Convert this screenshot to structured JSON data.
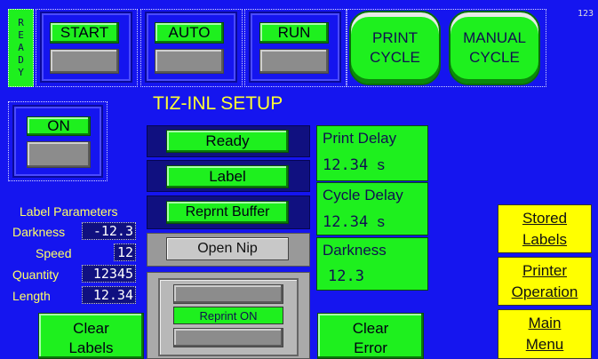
{
  "status": {
    "ready_vertical": "READY",
    "corner": "123"
  },
  "top_buttons": {
    "start": "START",
    "auto": "AUTO",
    "run": "RUN"
  },
  "cycle_buttons": {
    "print_line1": "PRINT",
    "print_line2": "CYCLE",
    "manual_line1": "MANUAL",
    "manual_line2": "CYCLE"
  },
  "title": "TIZ-INL SETUP",
  "on_button": "ON",
  "status_list": {
    "ready": "Ready",
    "label": "Label",
    "reprint_buffer": "Reprnt Buffer",
    "open_nip": "Open Nip"
  },
  "reprint": {
    "label": "Reprint ON"
  },
  "params": {
    "heading": "Label Parameters",
    "darkness_label": "Darkness",
    "darkness_value": "-12.3",
    "speed_label": "Speed",
    "speed_value": "12",
    "quantity_label": "Quantity",
    "quantity_value": "12345",
    "length_label": "Length",
    "length_value": "12.34"
  },
  "print_delay": {
    "label": "Print Delay",
    "value": "12.34",
    "unit": "s"
  },
  "cycle_delay": {
    "label": "Cycle Delay",
    "value": "12.34",
    "unit": "s"
  },
  "darkness_box": {
    "label": "Darkness",
    "value": "12.3"
  },
  "side_menu": {
    "stored_line1": "Stored",
    "stored_line2": "Labels",
    "printer_line1": "Printer",
    "printer_line2": "Operation",
    "main_line1": "Main",
    "main_line2": "Menu"
  },
  "bottom": {
    "clear_labels_line1": "Clear",
    "clear_labels_line2": "Labels",
    "clear_error_line1": "Clear",
    "clear_error_line2": "Error"
  },
  "colors": {
    "background": "#1515ef",
    "button_green": "#1ef01e",
    "menu_yellow": "#ffff00",
    "text_yellow": "#ffff66"
  }
}
